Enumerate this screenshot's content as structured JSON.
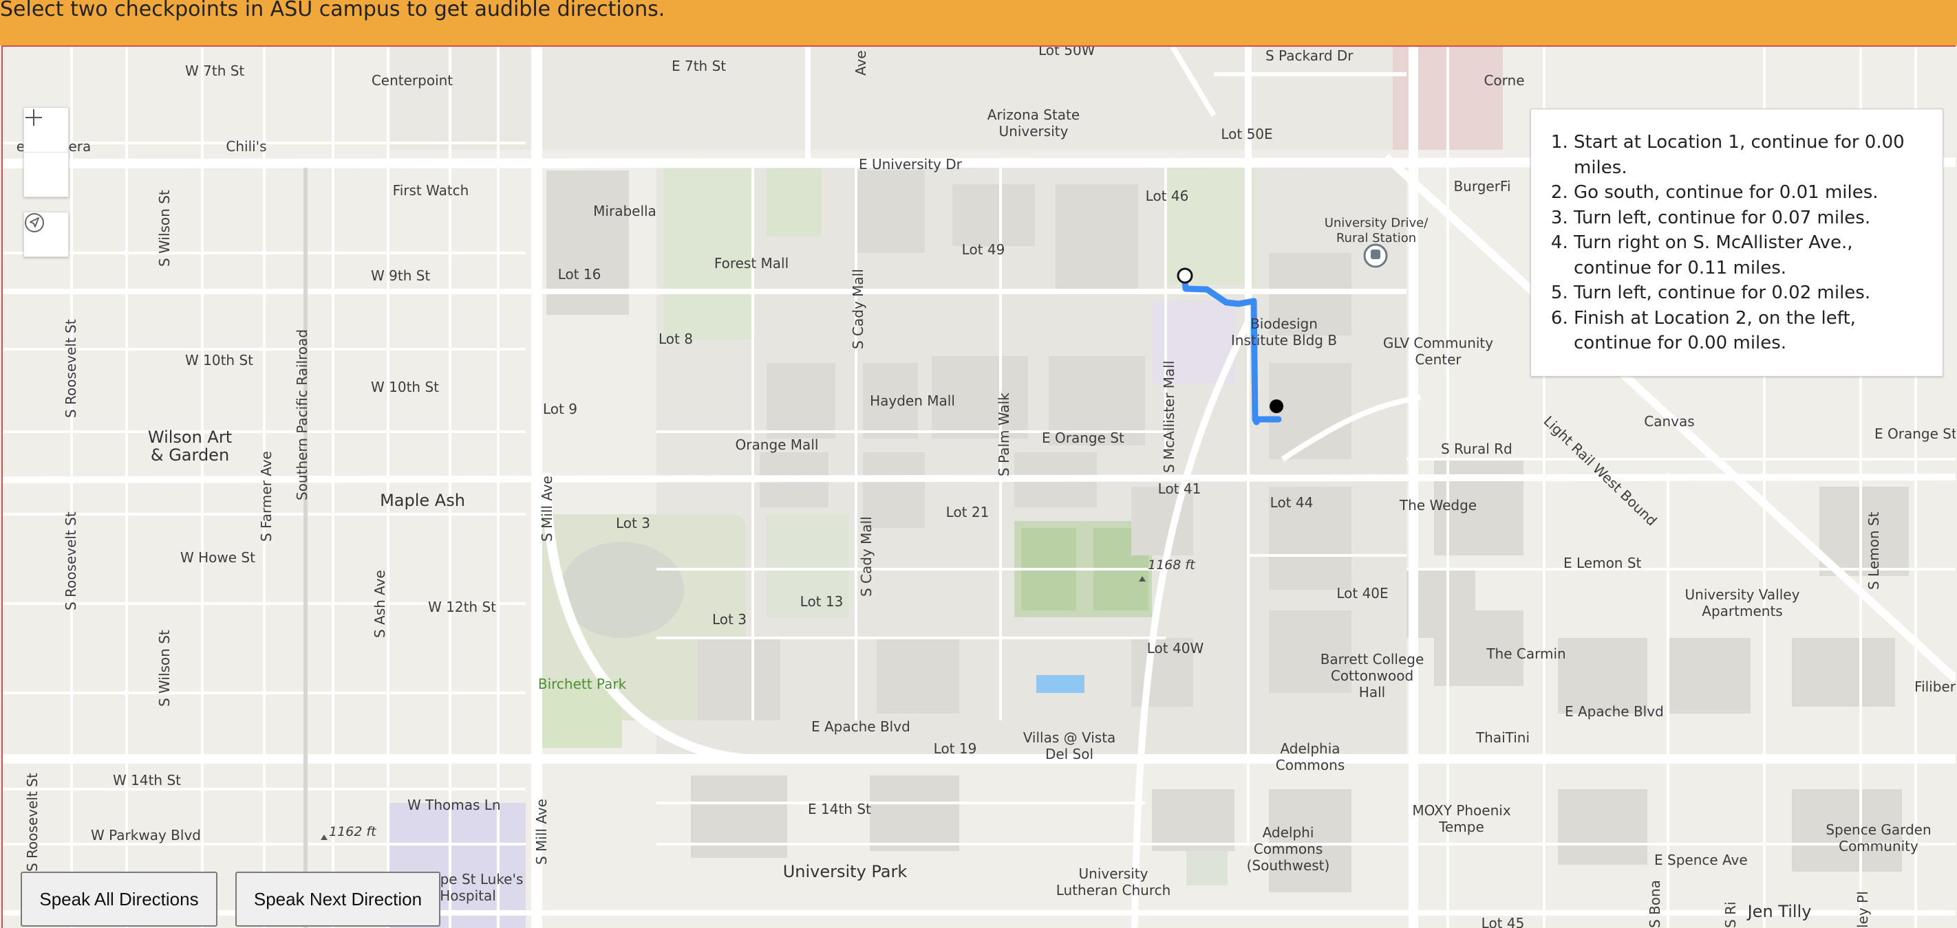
{
  "banner": {
    "text": "Select two checkpoints in ASU campus to get audible directions."
  },
  "controls": {
    "zoom_in": "+",
    "zoom_out": "—"
  },
  "directions": [
    "Start at Location 1, continue for 0.00 miles.",
    "Go south, continue for 0.01 miles.",
    "Turn left, continue for 0.07 miles.",
    "Turn right on S. McAllister Ave., continue for 0.11 miles.",
    "Turn left, continue for 0.02 miles.",
    "Finish at Location 2, on the left, continue for 0.00 miles."
  ],
  "buttons": {
    "speak_all": "Speak All Directions",
    "speak_next": "Speak Next Direction"
  },
  "map": {
    "colors": {
      "route": "#3b8cf2",
      "marker": "#000000",
      "background": "#efeee9"
    },
    "streets": {
      "w7th": "W 7th St",
      "e7th": "E 7th St",
      "lot50w": "Lot 50W",
      "packard": "S Packard Dr",
      "univ_dr": "E University Dr",
      "w9th": "W 9th St",
      "w10th_a": "W 10th St",
      "w10th_b": "W 10th St",
      "orange": "E Orange St",
      "orange_e": "E Orange St",
      "rural": "S Rural Rd",
      "lightrail": "Light Rail West Bound",
      "howe": "W Howe St",
      "w12th": "W 12th St",
      "lemon": "E Lemon St",
      "apache_w": "E Apache Blvd",
      "apache_e": "E Apache Blvd",
      "w14th": "W 14th St",
      "e14th": "E 14th St",
      "parkway": "W Parkway Blvd",
      "thomas": "W Thomas Ln",
      "spence": "E Spence Ave",
      "wilson1": "S Wilson St",
      "wilson2": "S Wilson St",
      "roosevelt1": "S Roosevelt St",
      "roosevelt2": "S Roosevelt St",
      "roosevelt3": "S Roosevelt St",
      "farmer": "S Farmer Ave",
      "sprr": "Southern Pacific Railroad",
      "ash": "S Ash Ave",
      "mill1": "S Mill Ave",
      "mill2": "S Mill Ave",
      "cady1": "S Cady Mall",
      "cady2": "S Cady Mall",
      "palm": "S Palm Walk",
      "mcallister": "S McAllister Mall",
      "lemon_st": "S Lemon St",
      "ave_top": "Ave",
      "bona": "S Bona",
      "ri": "S Ri",
      "ley": "ley Pl"
    },
    "places": {
      "centerpoint": "Centerpoint",
      "asu": "Arizona State",
      "asu2": "University",
      "lot50e": "Lot 50E",
      "corne": "Corne",
      "camera": "en, a mera",
      "chilis": "Chili's",
      "first_watch": "First Watch",
      "mirabella": "Mirabella",
      "lot46": "Lot 46",
      "burgerfi": "BurgerFi",
      "station1": "University Drive/",
      "station2": "Rural Station",
      "forest": "Forest Mall",
      "lot49": "Lot 49",
      "lot16": "Lot 16",
      "biodesign1": "Biodesign",
      "biodesign2": "Institute Bldg B",
      "glv1": "GLV Community",
      "glv2": "Center",
      "lot8": "Lot 8",
      "lot9": "Lot 9",
      "hayden": "Hayden Mall",
      "canvas": "Canvas",
      "wilson_art1": "Wilson Art",
      "wilson_art2": "& Garden",
      "orange_mall": "Orange Mall",
      "maple": "Maple Ash",
      "lot41": "Lot 41",
      "lot44": "Lot 44",
      "wedge": "The Wedge",
      "lot3a": "Lot 3",
      "lot21": "Lot 21",
      "elev1": "1168 ft",
      "lot40e": "Lot 40E",
      "uva1": "University Valley",
      "uva2": "Apartments",
      "lot13": "Lot 13",
      "lot3b": "Lot 3",
      "lot40w": "Lot 40W",
      "barrett1": "Barrett College",
      "barrett2": "Cottonwood",
      "barrett3": "Hall",
      "carmin": "The Carmin",
      "filiber": "Filiber",
      "birchett": "Birchett Park",
      "thaitini": "ThaiTini",
      "lot19": "Lot 19",
      "villas1": "Villas @ Vista",
      "villas2": "Del Sol",
      "adelphia1": "Adelphia",
      "adelphia2": "Commons",
      "moxy1": "MOXY Phoenix",
      "moxy2": "Tempe",
      "spence1": "Spence Garden",
      "spence2": "Community",
      "elev2": "1162 ft",
      "adelphi1": "Adelphi",
      "adelphi2": "Commons",
      "adelphi3": "(Southwest)",
      "univ_park": "University Park",
      "lutheran1": "University",
      "lutheran2": "Lutheran Church",
      "stlukes1": "pe St Luke's",
      "stlukes2": "Hospital",
      "jen": "Jen Tilly",
      "lot45": "Lot 45"
    }
  }
}
